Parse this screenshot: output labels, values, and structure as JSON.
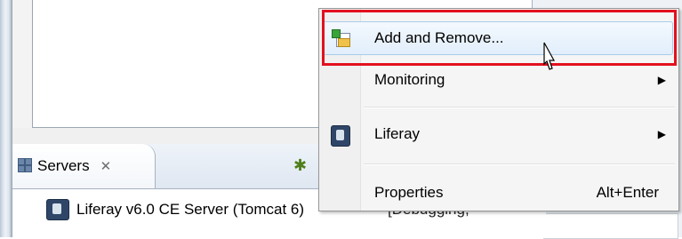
{
  "servers_view": {
    "tab_label": "Servers",
    "tab_close_glyph": "✕",
    "server_row_label": "Liferay v6.0 CE Server (Tomcat 6)",
    "partial_status_text": "[Debugging, "
  },
  "context_menu": {
    "items": [
      {
        "label": "Add and Remove...",
        "icon": "add-remove-icon",
        "highlighted": true
      },
      {
        "label": "Monitoring",
        "submenu_arrow": "▶"
      },
      {
        "label": "Liferay",
        "icon": "liferay-icon",
        "submenu_arrow": "▶"
      },
      {
        "label": "Properties",
        "shortcut": "Alt+Enter"
      }
    ]
  },
  "colors": {
    "annotation_red": "#e3101f",
    "highlight_border": "#a8cbe8",
    "menu_bg": "#f5f5f5"
  }
}
